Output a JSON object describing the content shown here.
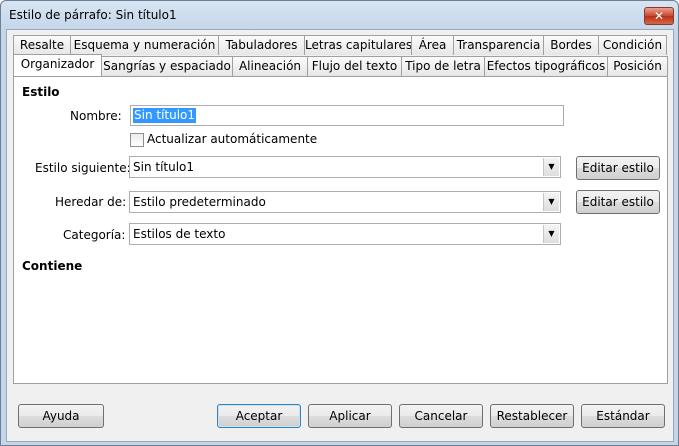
{
  "window": {
    "title": "Estilo de párrafo: Sin título1",
    "close_label": "✕"
  },
  "tabs_row1": [
    "Resalte",
    "Esquema y numeración",
    "Tabuladores",
    "Letras capitulares",
    "Área",
    "Transparencia",
    "Bordes",
    "Condición"
  ],
  "tabs_row2": [
    "Organizador",
    "Sangrías y espaciado",
    "Alineación",
    "Flujo del texto",
    "Tipo de letra",
    "Efectos tipográficos",
    "Posición"
  ],
  "active_tab": "Organizador",
  "style_section": {
    "heading": "Estilo",
    "name_label": "Nombre:",
    "name_value": "Sin título1",
    "auto_update_label": "Actualizar automáticamente",
    "auto_update_checked": false,
    "next_style_label": "Estilo siguiente:",
    "next_style_value": "Sin título1",
    "inherit_label": "Heredar de:",
    "inherit_value": "Estilo predeterminado",
    "category_label": "Categoría:",
    "category_value": "Estilos de texto",
    "edit_style_label": "Editar estilo"
  },
  "contains_section": {
    "heading": "Contiene"
  },
  "buttons": {
    "help": "Ayuda",
    "ok": "Aceptar",
    "apply": "Aplicar",
    "cancel": "Cancelar",
    "reset": "Restablecer",
    "standard": "Estándar"
  }
}
